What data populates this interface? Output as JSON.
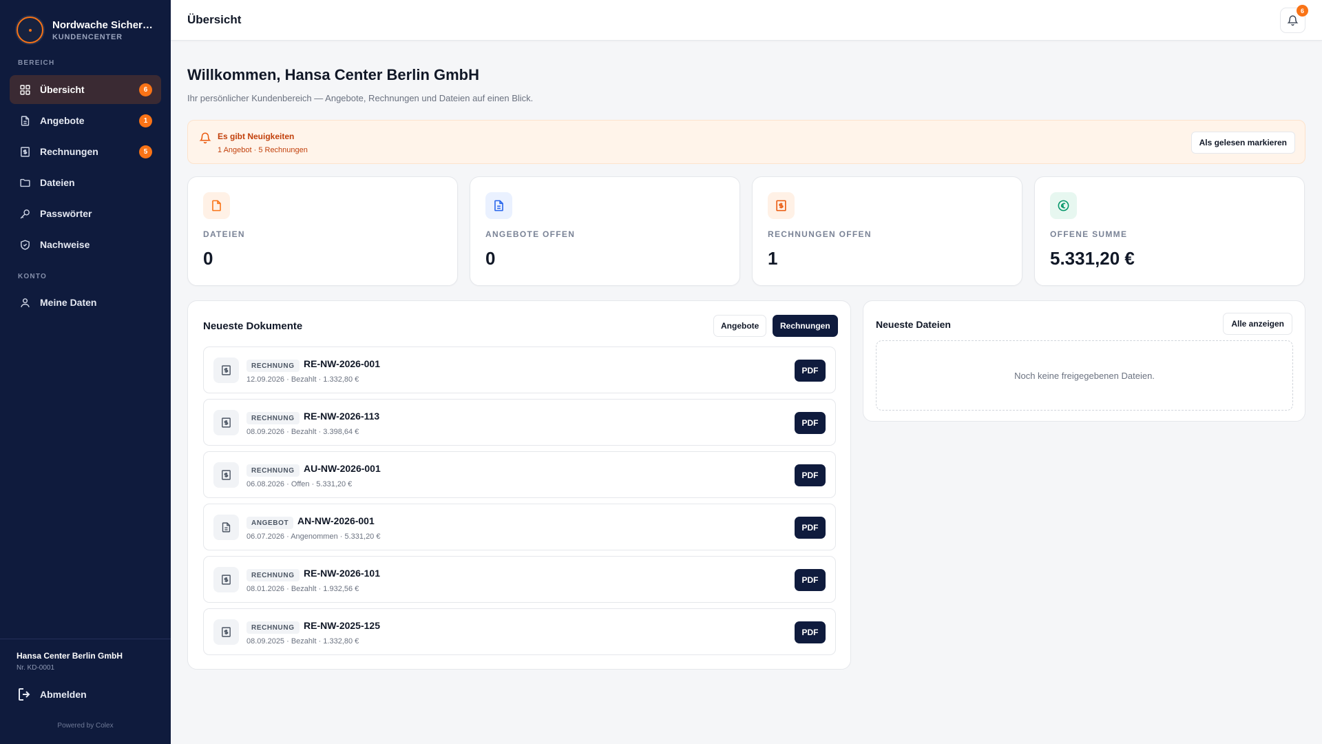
{
  "brand": {
    "name": "Nordwache Sicherh…",
    "subtitle": "KUNDENCENTER"
  },
  "sidebar": {
    "section_main": "BEREICH",
    "section_account": "KONTO",
    "items": [
      {
        "label": "Übersicht",
        "icon": "grid-icon",
        "badge": "6",
        "active": true
      },
      {
        "label": "Angebote",
        "icon": "document-icon",
        "badge": "1"
      },
      {
        "label": "Rechnungen",
        "icon": "invoice-icon",
        "badge": "5"
      },
      {
        "label": "Dateien",
        "icon": "folder-icon"
      },
      {
        "label": "Passwörter",
        "icon": "key-icon"
      },
      {
        "label": "Nachweise",
        "icon": "shield-icon"
      }
    ],
    "account_items": [
      {
        "label": "Meine Daten",
        "icon": "user-icon"
      }
    ],
    "customer_name": "Hansa Center Berlin GmbH",
    "customer_number": "Nr. KD-0001",
    "logout_label": "Abmelden",
    "powered_by": "Powered by Colex"
  },
  "topbar": {
    "title": "Übersicht",
    "notification_count": "6"
  },
  "welcome": {
    "title": "Willkommen, Hansa Center Berlin GmbH",
    "subtitle": "Ihr persönlicher Kundenbereich — Angebote, Rechnungen und Dateien auf einen Blick."
  },
  "notice": {
    "title": "Es gibt Neuigkeiten",
    "detail": "1 Angebot · 5 Rechnungen",
    "button": "Als gelesen markieren"
  },
  "stats": [
    {
      "label": "DATEIEN",
      "value": "0",
      "icon": "file-icon",
      "color": "#f97316"
    },
    {
      "label": "ANGEBOTE OFFEN",
      "value": "0",
      "icon": "document-icon",
      "color": "#2563eb"
    },
    {
      "label": "RECHNUNGEN OFFEN",
      "value": "1",
      "icon": "invoice-icon",
      "color": "#ea580c"
    },
    {
      "label": "OFFENE SUMME",
      "value": "5.331,20 €",
      "icon": "euro-icon",
      "color": "#059669"
    }
  ],
  "documents": {
    "title": "Neueste Dokumente",
    "filter_offers": "Angebote",
    "filter_invoices": "Rechnungen",
    "pdf_label": "PDF",
    "rows": [
      {
        "type": "RECHNUNG",
        "number": "RE-NW-2026-001",
        "meta": "12.09.2026 · Bezahlt · 1.332,80 €"
      },
      {
        "type": "RECHNUNG",
        "number": "RE-NW-2026-113",
        "meta": "08.09.2026 · Bezahlt · 3.398,64 €"
      },
      {
        "type": "RECHNUNG",
        "number": "AU-NW-2026-001",
        "meta": "06.08.2026 · Offen · 5.331,20 €"
      },
      {
        "type": "ANGEBOT",
        "number": "AN-NW-2026-001",
        "meta": "06.07.2026 · Angenommen · 5.331,20 €"
      },
      {
        "type": "RECHNUNG",
        "number": "RE-NW-2026-101",
        "meta": "08.01.2026 · Bezahlt · 1.932,56 €"
      },
      {
        "type": "RECHNUNG",
        "number": "RE-NW-2025-125",
        "meta": "08.09.2025 · Bezahlt · 1.332,80 €"
      }
    ]
  },
  "files": {
    "title": "Neueste Dateien",
    "show_all": "Alle anzeigen",
    "empty": "Noch keine freigegebenen Dateien."
  },
  "colors": {
    "sidebar": "#0f1b3d",
    "accent": "#f97316",
    "active_nav": "#3a2a33"
  }
}
